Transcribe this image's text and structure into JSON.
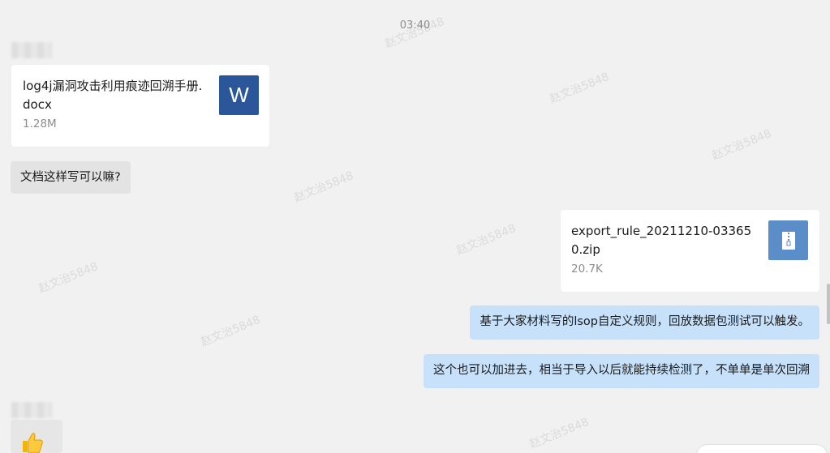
{
  "timestamp": "03:40",
  "watermark_text": "赵文治5848",
  "messages": {
    "incoming_file": {
      "name": "log4j漏洞攻击利用痕迹回溯手册.docx",
      "size": "1.28M",
      "icon": "word-doc-icon",
      "icon_letter": "W",
      "icon_color": "#2b579a"
    },
    "incoming_text": "文档这样写可以嘛?",
    "outgoing_file": {
      "name": "export_rule_20211210-033650.zip",
      "size": "20.7K",
      "icon": "zip-archive-icon",
      "icon_color": "#5b8dc9"
    },
    "outgoing_text_1": "基于大家材料写的lsop自定义规则，回放数据包测试可以触发。",
    "outgoing_text_2": "这个也可以加进去，相当于导入以后就能持续检测了，不单单是单次回溯",
    "reaction_icon": "thumbs-up-icon"
  },
  "colors": {
    "background": "#f1f1f1",
    "incoming_bubble": "#e3e3e3",
    "outgoing_bubble": "#c7e1fb"
  }
}
